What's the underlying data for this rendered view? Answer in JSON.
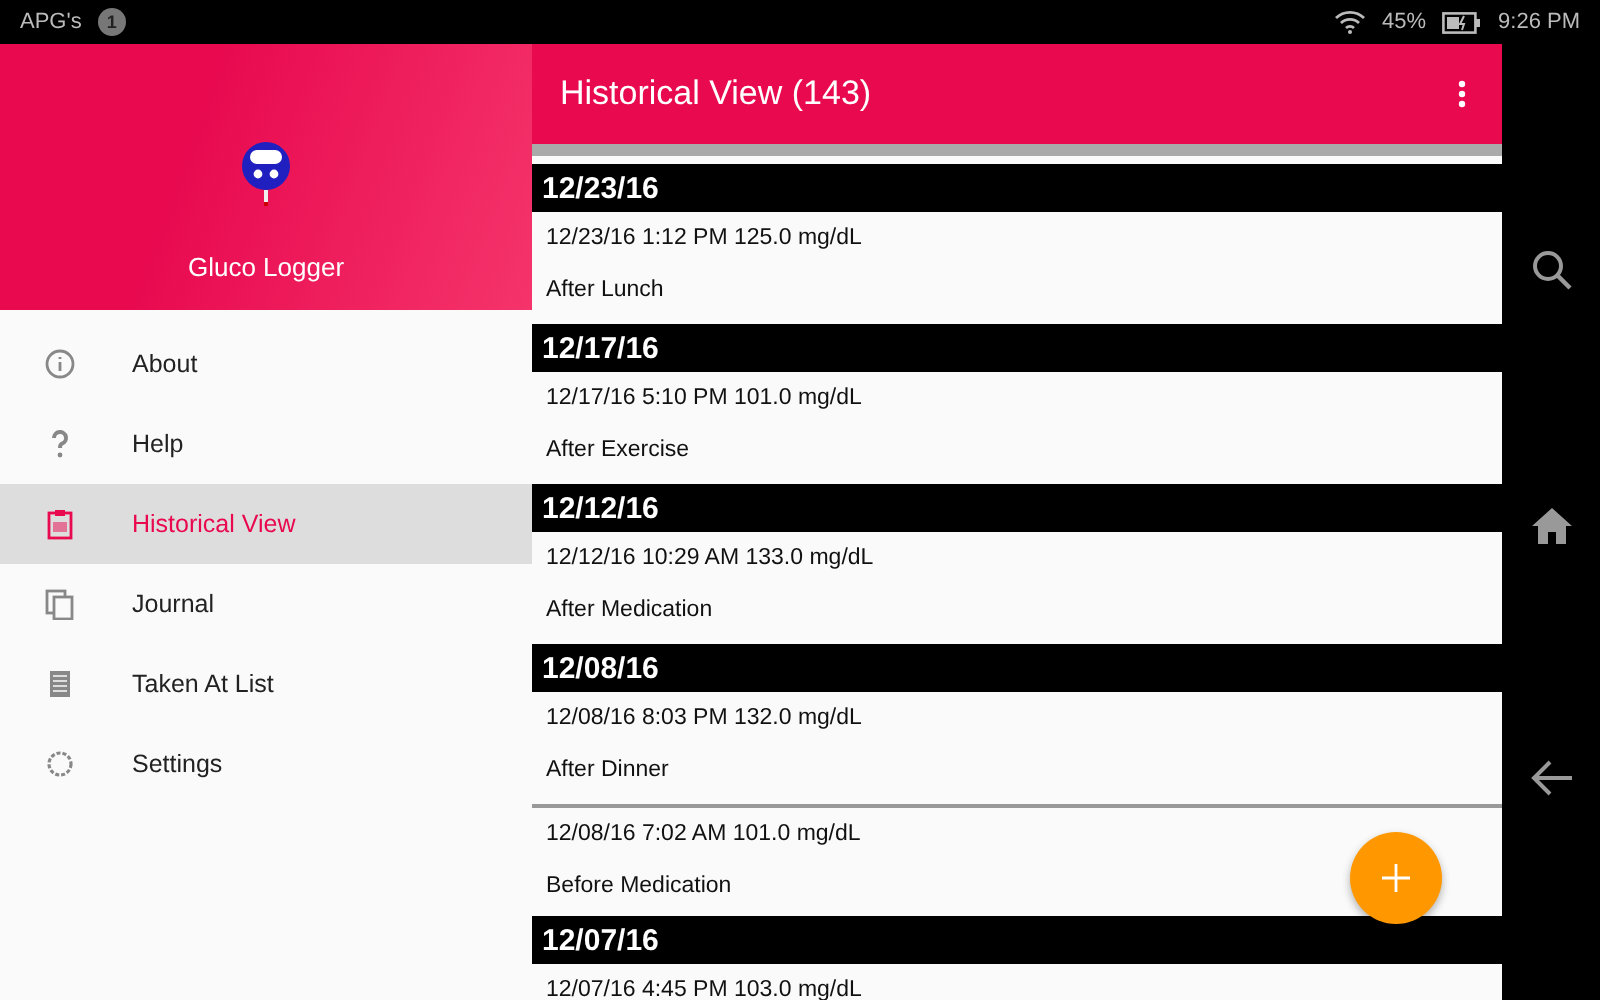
{
  "status_bar": {
    "carrier": "APG's",
    "notification_count": "1",
    "battery": "45%",
    "time": "9:26 PM"
  },
  "drawer": {
    "app_name": "Gluco Logger",
    "items": [
      {
        "label": "About",
        "kind": "info",
        "selected": false
      },
      {
        "label": "Help",
        "kind": "help",
        "selected": false
      },
      {
        "label": "Historical View",
        "kind": "clipboard",
        "selected": true
      },
      {
        "label": "Journal",
        "kind": "pages",
        "selected": false
      },
      {
        "label": "Taken At List",
        "kind": "list",
        "selected": false
      },
      {
        "label": "Settings",
        "kind": "gear",
        "selected": false
      }
    ]
  },
  "toolbar": {
    "title": "Historical View (143)"
  },
  "groups": [
    {
      "date": "12/23/16",
      "entries": [
        {
          "reading": "12/23/16 1:12 PM 125.0 mg/dL",
          "note": "After Lunch"
        }
      ]
    },
    {
      "date": "12/17/16",
      "entries": [
        {
          "reading": "12/17/16 5:10 PM 101.0 mg/dL",
          "note": "After Exercise"
        }
      ]
    },
    {
      "date": "12/12/16",
      "entries": [
        {
          "reading": "12/12/16 10:29 AM 133.0 mg/dL",
          "note": "After Medication"
        }
      ]
    },
    {
      "date": "12/08/16",
      "entries": [
        {
          "reading": "12/08/16 8:03 PM 132.0 mg/dL",
          "note": "After Dinner"
        },
        {
          "reading": "12/08/16 7:02 AM 101.0 mg/dL",
          "note": "Before Medication"
        }
      ]
    },
    {
      "date": "12/07/16",
      "entries": [
        {
          "reading": "12/07/16 4:45 PM 103.0 mg/dL"
        }
      ]
    }
  ]
}
